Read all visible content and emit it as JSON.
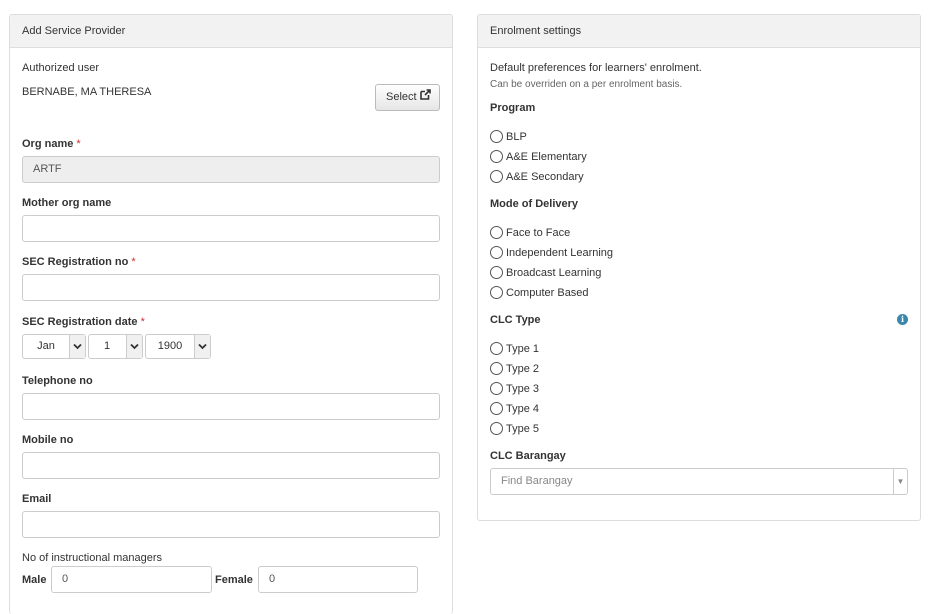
{
  "left_panel": {
    "title": "Add Service Provider",
    "authorized_user_label": "Authorized user",
    "authorized_user_value": "BERNABE, MA THERESA",
    "select_button": "Select",
    "org_name_label": "Org name",
    "org_name_value": "ARTF",
    "mother_org_label": "Mother org name",
    "mother_org_value": "",
    "sec_reg_no_label": "SEC Registration no",
    "sec_reg_no_value": "",
    "sec_reg_date_label": "SEC Registration date",
    "date_month": "Jan",
    "date_day": "1",
    "date_year": "1900",
    "telephone_label": "Telephone no",
    "telephone_value": "",
    "mobile_label": "Mobile no",
    "mobile_value": "",
    "email_label": "Email",
    "email_value": "",
    "instructional_managers_label": "No of instructional managers",
    "male_label": "Male",
    "male_value": "0",
    "female_label": "Female",
    "female_value": "0",
    "required_mark": "*"
  },
  "right_panel": {
    "title": "Enrolment settings",
    "description": "Default preferences for learners' enrolment.",
    "note": "Can be overriden on a per enrolment basis.",
    "program_label": "Program",
    "program_options": [
      "BLP",
      "A&E Elementary",
      "A&E Secondary"
    ],
    "delivery_label": "Mode of Delivery",
    "delivery_options": [
      "Face to Face",
      "Independent Learning",
      "Broadcast Learning",
      "Computer Based"
    ],
    "clc_type_label": "CLC Type",
    "clc_type_options": [
      "Type 1",
      "Type 2",
      "Type 3",
      "Type 4",
      "Type 5"
    ],
    "clc_barangay_label": "CLC Barangay",
    "clc_barangay_placeholder": "Find Barangay"
  },
  "colors": {
    "panel_heading_bg": "#f2f2f2",
    "border": "#dddddd",
    "required": "#c9302c",
    "info": "#3a87ad"
  },
  "icons": [
    "external-link-icon",
    "chevron-down-icon",
    "info-icon",
    "caret-down-icon"
  ]
}
